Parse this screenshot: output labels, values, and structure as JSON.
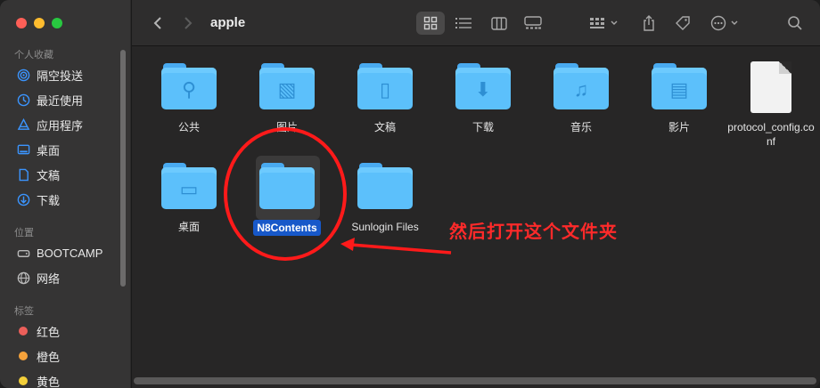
{
  "window": {
    "title": "apple"
  },
  "sidebar": {
    "favorites_heading": "个人收藏",
    "favorites": [
      {
        "label": "隔空投送",
        "icon": "airdrop-icon"
      },
      {
        "label": "最近使用",
        "icon": "clock-icon"
      },
      {
        "label": "应用程序",
        "icon": "applications-icon"
      },
      {
        "label": "桌面",
        "icon": "desktop-icon"
      },
      {
        "label": "文稿",
        "icon": "document-icon"
      },
      {
        "label": "下载",
        "icon": "download-icon"
      }
    ],
    "locations_heading": "位置",
    "locations": [
      {
        "label": "BOOTCAMP",
        "icon": "drive-icon"
      },
      {
        "label": "网络",
        "icon": "network-icon"
      }
    ],
    "tags_heading": "标签",
    "tags": [
      {
        "label": "红色",
        "color": "#ec5f5a"
      },
      {
        "label": "橙色",
        "color": "#f5a23b"
      },
      {
        "label": "黄色",
        "color": "#f3cf3a"
      }
    ]
  },
  "toolbar": {
    "back_icon": "chevron-left-icon",
    "forward_icon": "chevron-right-icon",
    "views": [
      "grid-view-icon",
      "list-view-icon",
      "column-view-icon",
      "gallery-view-icon"
    ],
    "group_icon": "group-icon",
    "share_icon": "share-icon",
    "tag_icon": "tag-icon",
    "more_icon": "ellipsis-icon",
    "search_icon": "search-icon"
  },
  "files": [
    {
      "name": "公共",
      "kind": "folder",
      "glyph": "⚲"
    },
    {
      "name": "图片",
      "kind": "folder",
      "glyph": "▧"
    },
    {
      "name": "文稿",
      "kind": "folder",
      "glyph": "▯"
    },
    {
      "name": "下载",
      "kind": "folder",
      "glyph": "⬇"
    },
    {
      "name": "音乐",
      "kind": "folder",
      "glyph": "♫"
    },
    {
      "name": "影片",
      "kind": "folder",
      "glyph": "▤"
    },
    {
      "name": "protocol_config.conf",
      "kind": "file"
    },
    {
      "name": "桌面",
      "kind": "folder",
      "glyph": "▭"
    },
    {
      "name": "N8Contents",
      "kind": "folder",
      "selected": true
    },
    {
      "name": "Sunlogin Files",
      "kind": "folder"
    }
  ],
  "annotation": {
    "text": "然后打开这个文件夹",
    "color": "#ff2a2a"
  }
}
